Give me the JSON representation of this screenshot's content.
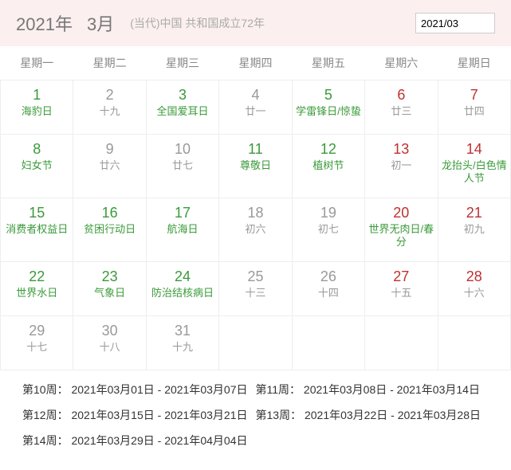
{
  "header": {
    "year": "2021年",
    "month": "3月",
    "subtitle": "(当代)中国 共和国成立72年",
    "input_value": "2021/03"
  },
  "weekdays": [
    "星期一",
    "星期二",
    "星期三",
    "星期四",
    "星期五",
    "星期六",
    "星期日"
  ],
  "rows": [
    [
      {
        "num": "1",
        "numColor": "green",
        "sub": "海豹日",
        "subColor": "green"
      },
      {
        "num": "2",
        "numColor": "",
        "sub": "十九",
        "subColor": ""
      },
      {
        "num": "3",
        "numColor": "green",
        "sub": "全国爱耳日",
        "subColor": "green"
      },
      {
        "num": "4",
        "numColor": "",
        "sub": "廿一",
        "subColor": ""
      },
      {
        "num": "5",
        "numColor": "green",
        "sub": "学雷锋日/惊蛰",
        "subColor": "green"
      },
      {
        "num": "6",
        "numColor": "red",
        "sub": "廿三",
        "subColor": ""
      },
      {
        "num": "7",
        "numColor": "red",
        "sub": "廿四",
        "subColor": ""
      }
    ],
    [
      {
        "num": "8",
        "numColor": "green",
        "sub": "妇女节",
        "subColor": "green"
      },
      {
        "num": "9",
        "numColor": "",
        "sub": "廿六",
        "subColor": ""
      },
      {
        "num": "10",
        "numColor": "",
        "sub": "廿七",
        "subColor": ""
      },
      {
        "num": "11",
        "numColor": "green",
        "sub": "尊敬日",
        "subColor": "green"
      },
      {
        "num": "12",
        "numColor": "green",
        "sub": "植树节",
        "subColor": "green"
      },
      {
        "num": "13",
        "numColor": "red",
        "sub": "初一",
        "subColor": ""
      },
      {
        "num": "14",
        "numColor": "red",
        "sub": "龙抬头/白色情人节",
        "subColor": "green"
      }
    ],
    [
      {
        "num": "15",
        "numColor": "green",
        "sub": "消费者权益日",
        "subColor": "green"
      },
      {
        "num": "16",
        "numColor": "green",
        "sub": "贫困行动日",
        "subColor": "green"
      },
      {
        "num": "17",
        "numColor": "green",
        "sub": "航海日",
        "subColor": "green"
      },
      {
        "num": "18",
        "numColor": "",
        "sub": "初六",
        "subColor": ""
      },
      {
        "num": "19",
        "numColor": "",
        "sub": "初七",
        "subColor": ""
      },
      {
        "num": "20",
        "numColor": "red",
        "sub": "世界无肉日/春分",
        "subColor": "green"
      },
      {
        "num": "21",
        "numColor": "red",
        "sub": "初九",
        "subColor": ""
      }
    ],
    [
      {
        "num": "22",
        "numColor": "green",
        "sub": "世界水日",
        "subColor": "green"
      },
      {
        "num": "23",
        "numColor": "green",
        "sub": "气象日",
        "subColor": "green"
      },
      {
        "num": "24",
        "numColor": "green",
        "sub": "防治结核病日",
        "subColor": "green"
      },
      {
        "num": "25",
        "numColor": "",
        "sub": "十三",
        "subColor": ""
      },
      {
        "num": "26",
        "numColor": "",
        "sub": "十四",
        "subColor": ""
      },
      {
        "num": "27",
        "numColor": "red",
        "sub": "十五",
        "subColor": ""
      },
      {
        "num": "28",
        "numColor": "red",
        "sub": "十六",
        "subColor": ""
      }
    ],
    [
      {
        "num": "29",
        "numColor": "",
        "sub": "十七",
        "subColor": ""
      },
      {
        "num": "30",
        "numColor": "",
        "sub": "十八",
        "subColor": ""
      },
      {
        "num": "31",
        "numColor": "",
        "sub": "十九",
        "subColor": ""
      },
      {
        "num": "",
        "numColor": "",
        "sub": "",
        "subColor": ""
      },
      {
        "num": "",
        "numColor": "",
        "sub": "",
        "subColor": ""
      },
      {
        "num": "",
        "numColor": "",
        "sub": "",
        "subColor": ""
      },
      {
        "num": "",
        "numColor": "",
        "sub": "",
        "subColor": ""
      }
    ]
  ],
  "weeks": [
    [
      {
        "label": "第10周：",
        "range": "2021年03月01日 - 2021年03月07日"
      },
      {
        "label": "第11周：",
        "range": "2021年03月08日 - 2021年03月14日"
      }
    ],
    [
      {
        "label": "第12周：",
        "range": "2021年03月15日 - 2021年03月21日"
      },
      {
        "label": "第13周：",
        "range": "2021年03月22日 - 2021年03月28日"
      }
    ],
    [
      {
        "label": "第14周：",
        "range": "2021年03月29日 - 2021年04月04日"
      }
    ]
  ]
}
